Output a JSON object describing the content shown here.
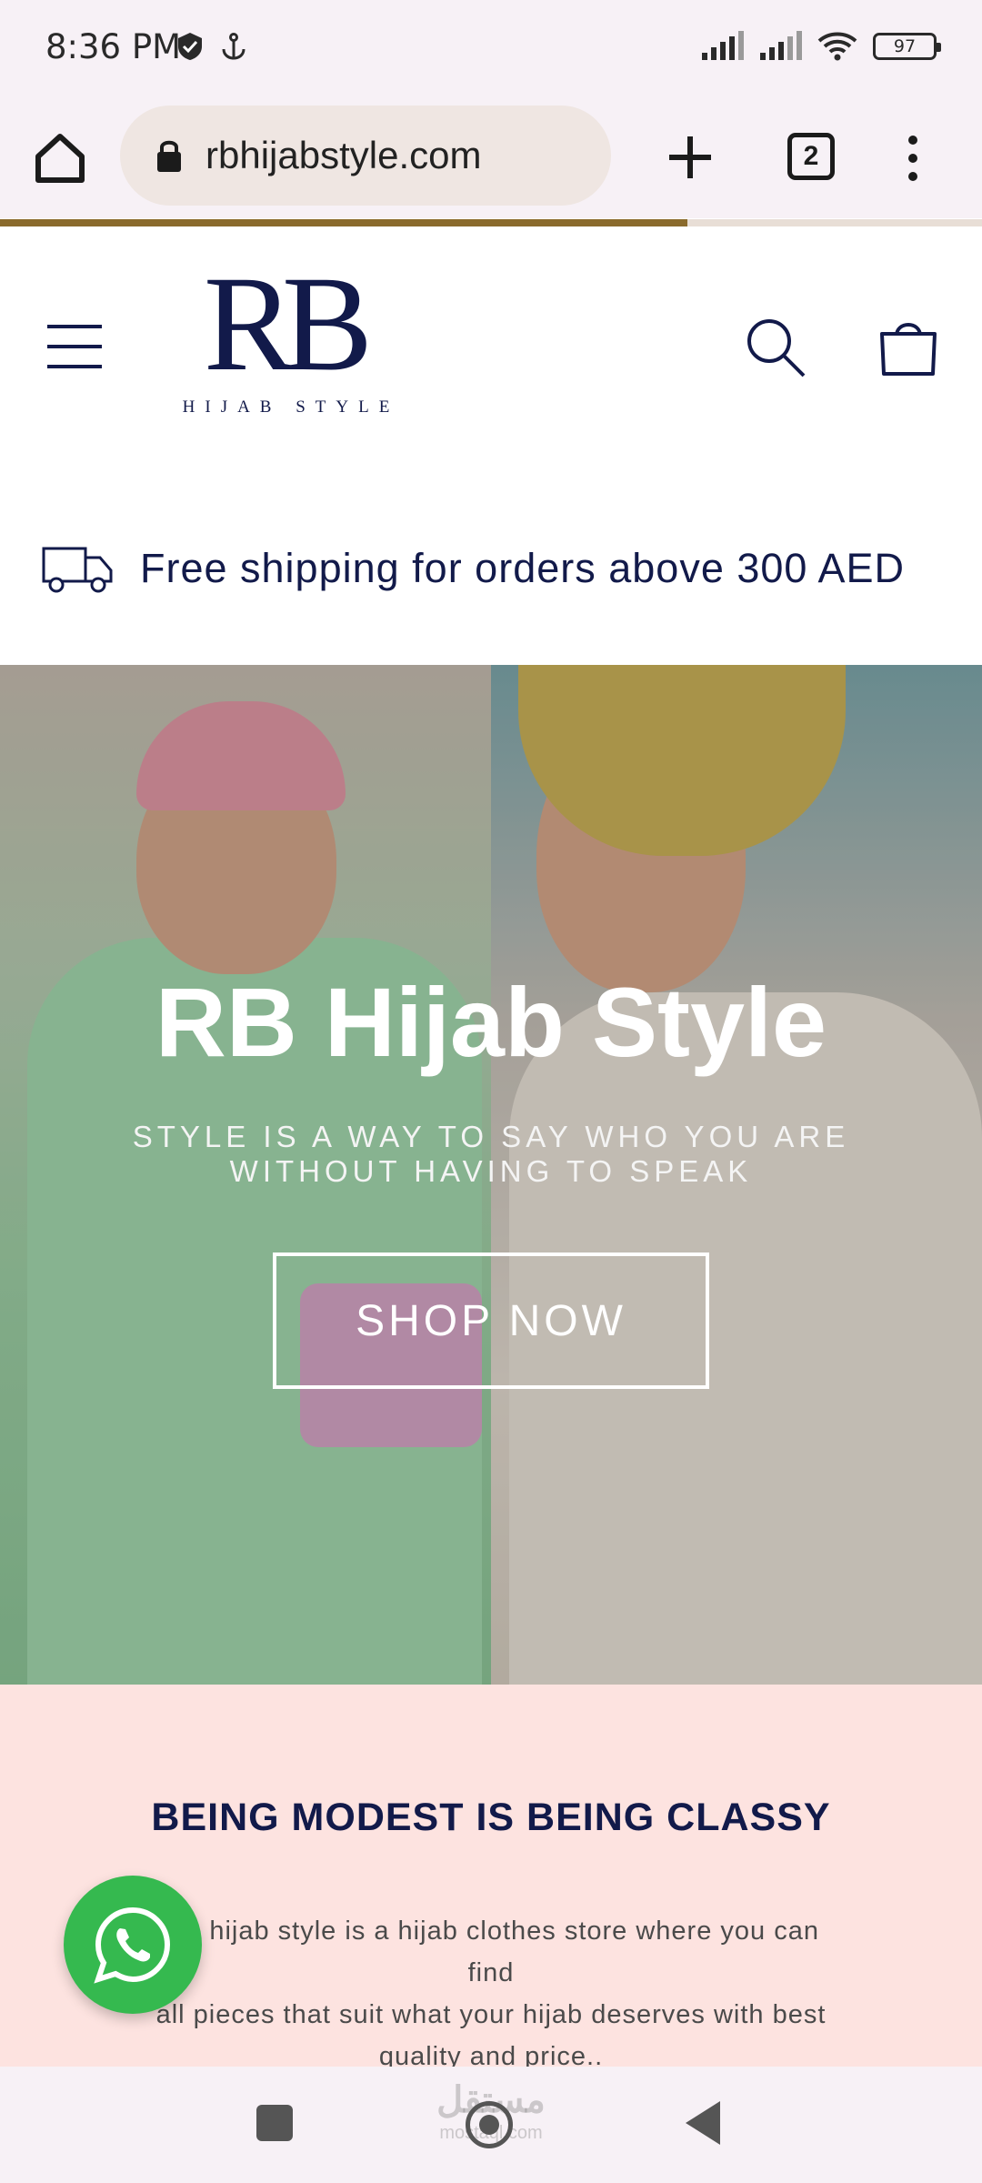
{
  "status_bar": {
    "time": "8:36 PM",
    "battery": "97"
  },
  "browser": {
    "url": "rbhijabstyle.com",
    "tab_count": "2",
    "load_progress": 0.7
  },
  "site": {
    "logo_monogram": "RB",
    "logo_tagline": "HIJAB STYLE",
    "shipping_text": "Free shipping for orders above 300 AED"
  },
  "hero": {
    "title": "RB Hijab Style",
    "subtitle_line1": "STYLE IS A WAY TO SAY WHO YOU ARE",
    "subtitle_line2": "WITHOUT HAVING TO SPEAK",
    "button_label": "SHOP NOW"
  },
  "info": {
    "title": "BEING MODEST IS BEING CLASSY",
    "body_line1": "RB hijab style is a hijab clothes store where you can find",
    "body_line2": "all pieces that suit what your hijab deserves with best",
    "body_line3": "quality and price.."
  },
  "watermark": {
    "arabic": "مستقل",
    "latin": "mostaql.com"
  },
  "colors": {
    "brand_navy": "#121a4a",
    "info_bg": "#fde3e0",
    "whatsapp_green": "#35b94f",
    "progress": "#8a6a2c"
  }
}
